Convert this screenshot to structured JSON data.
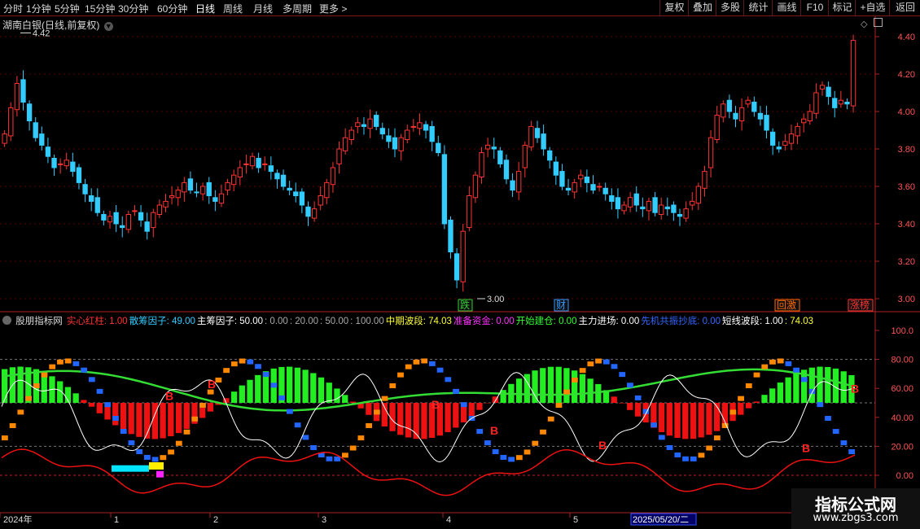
{
  "toolbar": {
    "periods": [
      "分时",
      "1分钟",
      "5分钟",
      "15分钟",
      "30分钟",
      "60分钟",
      "日线",
      "周线",
      "月线",
      "多周期",
      "更多 >"
    ],
    "active_period": "日线",
    "right_buttons": [
      "复权",
      "叠加",
      "多股",
      "统计",
      "画线",
      "F10",
      "标记",
      "+自选",
      "返回"
    ]
  },
  "main_chart": {
    "title": "湖南白银(日线,前复权)",
    "price_ticks": [
      "4.40",
      "4.20",
      "4.00",
      "3.80",
      "3.60",
      "3.40",
      "3.20",
      "3.00"
    ],
    "high_label": "4.42",
    "low_label": "3.00",
    "markers": [
      "跌",
      "财",
      "回激",
      "涨榜"
    ],
    "colors": {
      "up": "#ff3333",
      "down": "#33ccff",
      "grid": "#5a0000",
      "axis": "#aa2222"
    }
  },
  "indicator": {
    "name": "股朋指标网",
    "fields": [
      {
        "label": "实心红柱",
        "value": "1.00",
        "color": "#ff3333"
      },
      {
        "label": "散筹因子",
        "value": "49.00",
        "color": "#33ccff"
      },
      {
        "label": "主筹因子",
        "value": "50.00",
        "color": "#ffffff"
      },
      {
        "label": "",
        "value": "0.00",
        "color": "#aaaaaa"
      },
      {
        "label": "",
        "value": "20.00",
        "color": "#aaaaaa"
      },
      {
        "label": "",
        "value": "50.00",
        "color": "#aaaaaa"
      },
      {
        "label": "",
        "value": "100.00",
        "color": "#aaaaaa"
      },
      {
        "label": "中期波段",
        "value": "74.03",
        "color": "#ffff33"
      },
      {
        "label": "准备资金",
        "value": "0.00",
        "color": "#ff33ff"
      },
      {
        "label": "开始建仓",
        "value": "0.00",
        "color": "#33ff33"
      },
      {
        "label": "主力进场",
        "value": "0.00",
        "color": "#ffffff"
      },
      {
        "label": "先机共振抄底",
        "value": "0.00",
        "color": "#3366ff"
      },
      {
        "label": "短线波段",
        "value": "1.00",
        "color": "#ffffff"
      },
      {
        "label": "",
        "value": "74.03",
        "color": "#ffff33"
      }
    ],
    "ticks": [
      "100.0",
      "80.00",
      "60.00",
      "40.00",
      "20.00",
      "0.00"
    ],
    "buy_marker": "B"
  },
  "time_axis": {
    "labels": [
      "2024年",
      "1",
      "2",
      "3",
      "4",
      "5"
    ],
    "cursor_date": "2025/05/20/二"
  },
  "watermark": {
    "title": "指标公式网",
    "url": "www.zbgs3.com"
  }
}
